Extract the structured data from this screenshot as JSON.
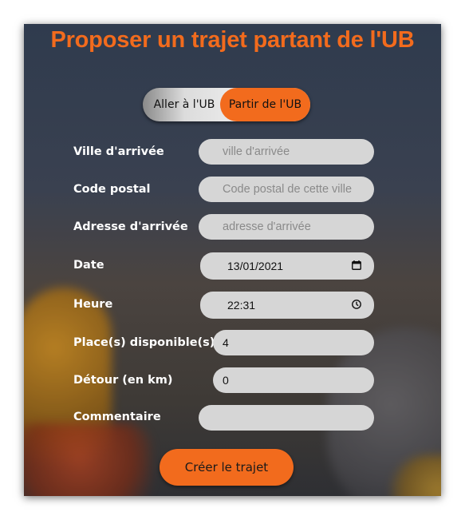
{
  "title": "Proposer un trajet partant de l'UB",
  "toggle": {
    "left_label": "Aller à l'UB",
    "right_label": "Partir de l'UB",
    "active": "right"
  },
  "form": {
    "ville": {
      "label": "Ville d'arrivée",
      "placeholder": "ville d'arrivée",
      "value": ""
    },
    "code_postal": {
      "label": "Code postal",
      "placeholder": "Code postal de cette ville",
      "value": ""
    },
    "adresse": {
      "label": "Adresse d'arrivée",
      "placeholder": "adresse d'arrivée",
      "value": ""
    },
    "date": {
      "label": "Date",
      "value": "13/01/2021",
      "icon": "calendar-icon"
    },
    "heure": {
      "label": "Heure",
      "value": "22:31",
      "icon": "clock-icon"
    },
    "places": {
      "label": "Place(s) disponible(s)",
      "value": "4"
    },
    "detour": {
      "label": "Détour (en km)",
      "value": "0"
    },
    "commentaire": {
      "label": "Commentaire",
      "value": ""
    }
  },
  "submit": {
    "label": "Créer le trajet"
  },
  "colors": {
    "accent": "#f26b1d",
    "field_bg": "#d6d6d6",
    "label_text": "#ffffff"
  }
}
